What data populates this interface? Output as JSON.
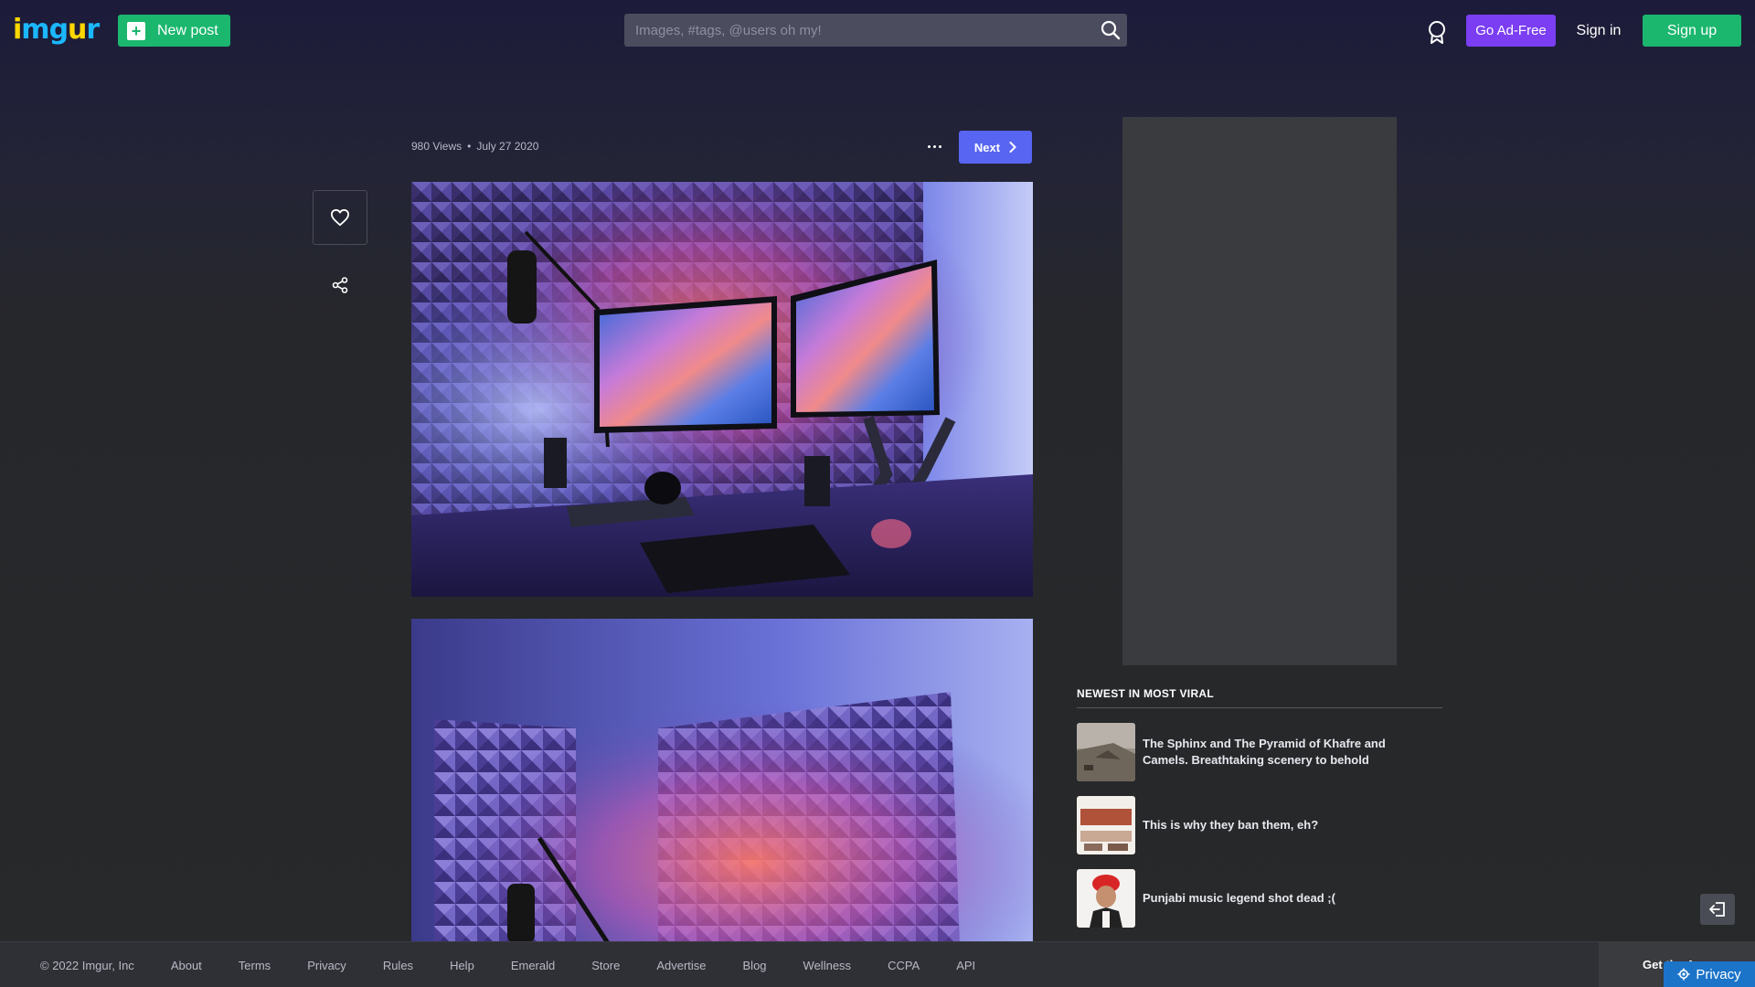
{
  "header": {
    "logo_letters": [
      "i",
      "m",
      "g",
      "u",
      "r"
    ],
    "logo_colors": [
      "#ffd700",
      "#1bb7ff",
      "#1bb7ff",
      "#ffd700",
      "#1bb7ff"
    ],
    "new_post_label": "New post",
    "search_placeholder": "Images, #tags, @users oh my!",
    "go_ad_free_label": "Go Ad-Free",
    "sign_in_label": "Sign in",
    "sign_up_label": "Sign up"
  },
  "post": {
    "views": "980 Views",
    "separator": "•",
    "date": "July 27 2020",
    "next_label": "Next"
  },
  "newest": {
    "title": "NEWEST IN MOST VIRAL",
    "items": [
      {
        "text": "The Sphinx and The Pyramid of Khafre and Camels. Breathtaking scenery to behold"
      },
      {
        "text": "This is why they ban them, eh?"
      },
      {
        "text": "Punjabi music legend shot dead ;("
      }
    ]
  },
  "footer": {
    "copyright": "© 2022 Imgur, Inc",
    "links": [
      "About",
      "Terms",
      "Privacy",
      "Rules",
      "Help",
      "Emerald",
      "Store",
      "Advertise",
      "Blog",
      "Wellness",
      "CCPA",
      "API"
    ],
    "app_text": "Get the App",
    "privacy_label": "Privacy"
  },
  "colors": {
    "green": "#1bb76e",
    "purple": "#7b3ef2",
    "blue": "#5865f2"
  }
}
